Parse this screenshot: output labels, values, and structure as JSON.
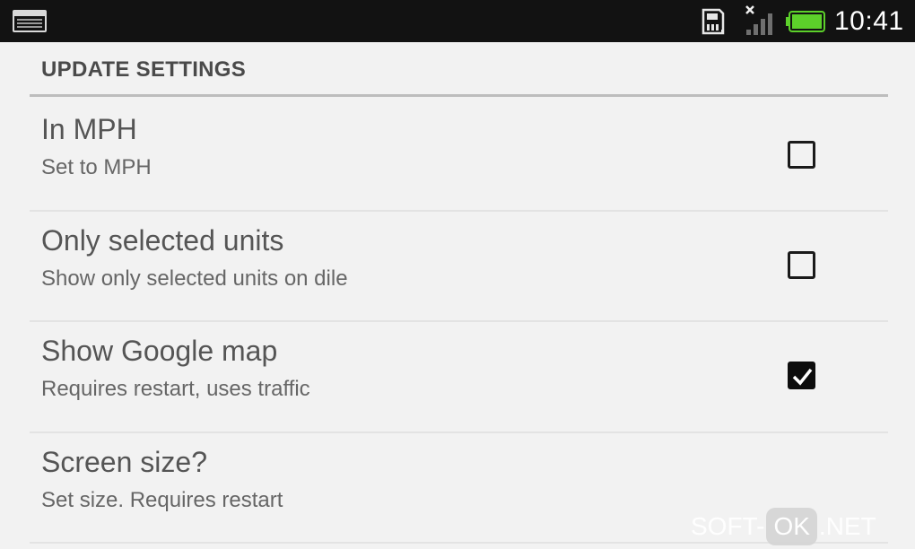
{
  "status_bar": {
    "time": "10:41",
    "icons": [
      "notification-icon",
      "sd-card-icon",
      "signal-icon",
      "battery-icon"
    ],
    "battery_color": "#5cd02a"
  },
  "section": {
    "header": "UPDATE SETTINGS"
  },
  "preferences": [
    {
      "title": "In MPH",
      "summary": "Set to MPH",
      "checked": false
    },
    {
      "title": "Only selected units",
      "summary": "Show only selected units on dile",
      "checked": false
    },
    {
      "title": "Show Google map",
      "summary": "Requires restart, uses traffic",
      "checked": true
    },
    {
      "title": "Screen size?",
      "summary": "Set size. Requires restart"
    }
  ],
  "watermark": {
    "prefix": "SOFT-",
    "highlight": "OK",
    "suffix": ".NET"
  }
}
